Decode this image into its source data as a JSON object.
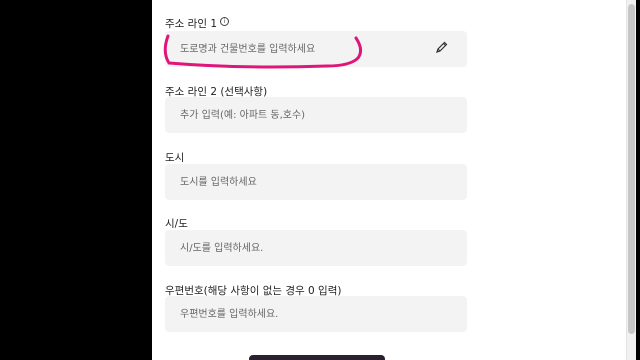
{
  "form": {
    "address1": {
      "label": "주소 라인 1",
      "info_icon": "info-circle-icon",
      "placeholder": "도로명과 건물번호를 입력하세요"
    },
    "address2": {
      "label": "주소 라인 2 (선택사항)",
      "placeholder": "추가 입력(예: 아파트 동,호수)"
    },
    "city": {
      "label": "도시",
      "placeholder": "도시를 입력하세요"
    },
    "state": {
      "label": "시/도",
      "placeholder": "시/도를 입력하세요."
    },
    "postal": {
      "label": "우편번호(해당 사항이 없는 경우 0 입력)",
      "placeholder": "우편번호를 입력하세요."
    }
  },
  "icons": {
    "edit": "pencil-edit-icon",
    "info": "info-circle-icon"
  },
  "colors": {
    "annotation": "#e0157a",
    "field_bg": "#f3f3f3",
    "backdrop": "#000000"
  }
}
